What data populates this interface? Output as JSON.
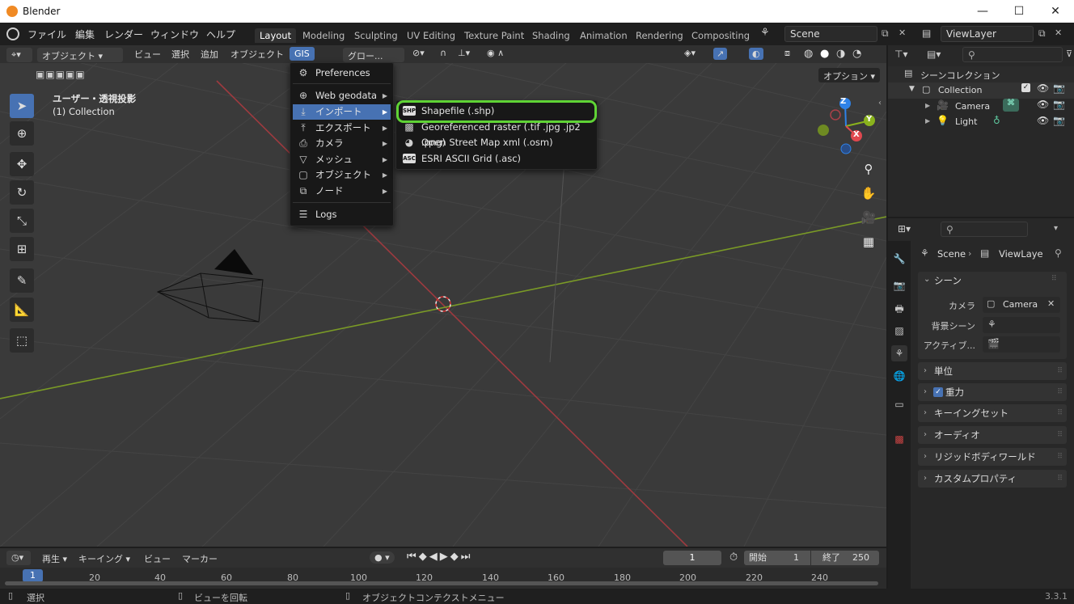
{
  "window": {
    "title": "Blender",
    "minimize": "—",
    "maximize": "☐",
    "close": "✕"
  },
  "topmenu": {
    "items": [
      "ファイル",
      "編集",
      "レンダー",
      "ウィンドウ",
      "ヘルプ"
    ],
    "workspaces": [
      "Layout",
      "Modeling",
      "Sculpting",
      "UV Editing",
      "Texture Paint",
      "Shading",
      "Animation",
      "Rendering",
      "Compositing"
    ],
    "active_workspace": "Layout",
    "scene": "Scene",
    "viewlayer": "ViewLayer"
  },
  "viewport_header": {
    "mode": "オブジェクト",
    "menus": [
      "ビュー",
      "選択",
      "追加",
      "オブジェクト",
      "GIS"
    ],
    "transform_orientation": "グロー...",
    "options": "オプション"
  },
  "viewport": {
    "view_name": "ユーザー・透視投影",
    "collection_name": "(1) Collection",
    "gizmo": {
      "x": "X",
      "y": "Y",
      "z": "Z"
    }
  },
  "gis_menu": {
    "items": [
      {
        "label": "Preferences",
        "icon": "gear-icon"
      },
      {
        "label": "Web geodata",
        "icon": "globe-icon",
        "submenu": true
      },
      {
        "label": "インポート",
        "icon": "import-icon",
        "submenu": true,
        "selected": true
      },
      {
        "label": "エクスポート",
        "icon": "export-icon",
        "submenu": true
      },
      {
        "label": "カメラ",
        "icon": "camera-icon",
        "submenu": true
      },
      {
        "label": "メッシュ",
        "icon": "mesh-icon",
        "submenu": true
      },
      {
        "label": "オブジェクト",
        "icon": "object-icon",
        "submenu": true
      },
      {
        "label": "ノード",
        "icon": "node-icon",
        "submenu": true
      },
      {
        "label": "Logs",
        "icon": "logs-icon"
      }
    ]
  },
  "import_submenu": {
    "items": [
      {
        "label": "Shapefile (.shp)",
        "icon": "shp-icon",
        "highlight_color": "#5fd335"
      },
      {
        "label": "Georeferenced raster (.tif .jpg .jp2 .png)",
        "icon": "raster-icon"
      },
      {
        "label": "Open Street Map xml (.osm)",
        "icon": "osm-icon"
      },
      {
        "label": "ESRI ASCII Grid (.asc)",
        "icon": "asc-icon"
      }
    ]
  },
  "outliner": {
    "title": "シーンコレクション",
    "rows": [
      {
        "label": "Collection"
      },
      {
        "label": "Camera"
      },
      {
        "label": "Light"
      }
    ]
  },
  "properties": {
    "breadcrumb": [
      "Scene",
      "ViewLaye"
    ],
    "section": "シーン",
    "fields": [
      {
        "label": "カメラ",
        "value": "Camera"
      },
      {
        "label": "背景シーン",
        "value": ""
      },
      {
        "label": "アクティブ...",
        "value": ""
      }
    ],
    "panels": [
      "単位",
      "重力",
      "キーイングセット",
      "オーディオ",
      "リジッドボディワールド",
      "カスタムプロパティ"
    ]
  },
  "timeline": {
    "menus": [
      "再生",
      "キーイング",
      "ビュー",
      "マーカー"
    ],
    "current_frame": "1",
    "start_label": "開始",
    "start": "1",
    "end_label": "終了",
    "end": "250",
    "ticks": [
      "1",
      "20",
      "40",
      "60",
      "80",
      "100",
      "120",
      "140",
      "160",
      "180",
      "200",
      "220",
      "240"
    ]
  },
  "statusbar": {
    "items": [
      "選択",
      "ビューを回転",
      "オブジェクトコンテクストメニュー"
    ],
    "version": "3.3.1"
  },
  "colors": {
    "accent": "#4772b3",
    "highlight": "#5fd335",
    "x_axis": "#e0484f",
    "y_axis": "#8ab31d",
    "z_axis": "#2f82e8"
  }
}
